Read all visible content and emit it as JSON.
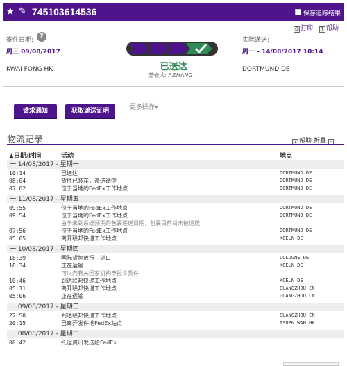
{
  "header": {
    "tracking_number": "745103614536",
    "save_label": "保存追踪结果",
    "print_label": "打印",
    "help_label": "帮助"
  },
  "shipment": {
    "ship_date_label": "寄件日期:",
    "ship_date": "周三 09/08/2017",
    "origin": "KWAI FONG HK",
    "status": "已送达",
    "signed_by_label": "签收人:",
    "signed_by": "F.ZHANG",
    "delivery_label": "实际递送:",
    "delivery_date": "周一 - 14/08/2017 10:14",
    "destination": "DORTMUND DE",
    "progress_steps": 4,
    "progress_completed": 4
  },
  "actions": {
    "notify_button": "请求通知",
    "proof_button": "获取递送证明",
    "more_actions": "更多操作▾"
  },
  "log": {
    "title": "物流记录",
    "help_label": "帮助",
    "collapse_label": "折叠",
    "columns": {
      "datetime": "▲日期/时间",
      "activity": "活动",
      "location": "地点"
    },
    "days": [
      {
        "header": "一  14/08/2017 - 星期一",
        "events": [
          {
            "time": "10:14",
            "activity": "已送达",
            "location": "DORTMUND DE"
          },
          {
            "time": "08:04",
            "activity": "货件已装车，派送途中",
            "location": "DORTMUND DE"
          },
          {
            "time": "07:02",
            "activity": "位于当地的FedEx工作地点",
            "location": "DORTMUND DE"
          }
        ]
      },
      {
        "header": "一  11/08/2017 - 星期五",
        "events": [
          {
            "time": "09:55",
            "activity": "位于当地的FedEx工作地点",
            "location": "DORTMUND DE"
          },
          {
            "time": "09:54",
            "activity": "位于当地的FedEx工作地点",
            "location": "DORTMUND DE"
          },
          {
            "time": "",
            "activity": "由于未到系统预期的包裹递送日期，包裹目前尚未被递送",
            "location": "",
            "note": true
          },
          {
            "time": "07:56",
            "activity": "位于当地的FedEx工作地点",
            "location": "DORTMUND DE"
          },
          {
            "time": "05:05",
            "activity": "离开联邦快递工作地点",
            "location": "KOELN DE"
          }
        ]
      },
      {
        "header": "一  10/08/2017 - 星期四",
        "events": [
          {
            "time": "18:39",
            "activity": "国际货物放行 - 进口",
            "location": "COLOGNE DE"
          },
          {
            "time": "18:34",
            "activity": "正在运输",
            "location": "KOELN DE"
          },
          {
            "time": "",
            "activity": "可以向有关国家机构申报本货件",
            "location": "",
            "note": true
          },
          {
            "time": "10:46",
            "activity": "到达联邦快递工作地点",
            "location": "KOELN DE"
          },
          {
            "time": "05:11",
            "activity": "离开联邦快递工作地点",
            "location": "GUANGZHOU CN"
          },
          {
            "time": "05:06",
            "activity": "正在运输",
            "location": "GUANGZHOU CN"
          }
        ]
      },
      {
        "header": "一  09/08/2017 - 星期三",
        "events": [
          {
            "time": "22:50",
            "activity": "到达联邦快递工作地点",
            "location": "GUANGZHOU CN"
          },
          {
            "time": "20:15",
            "activity": "已离开发件地FedEx站点",
            "location": "TSUEN WAN HK"
          }
        ]
      },
      {
        "header": "一  08/08/2017 - 星期二",
        "events": [
          {
            "time": "00:42",
            "activity": "托运资讯发送给FedEx",
            "location": ""
          }
        ]
      }
    ]
  },
  "colors": {
    "brand": "#4d148c",
    "success": "#2e8b57"
  }
}
